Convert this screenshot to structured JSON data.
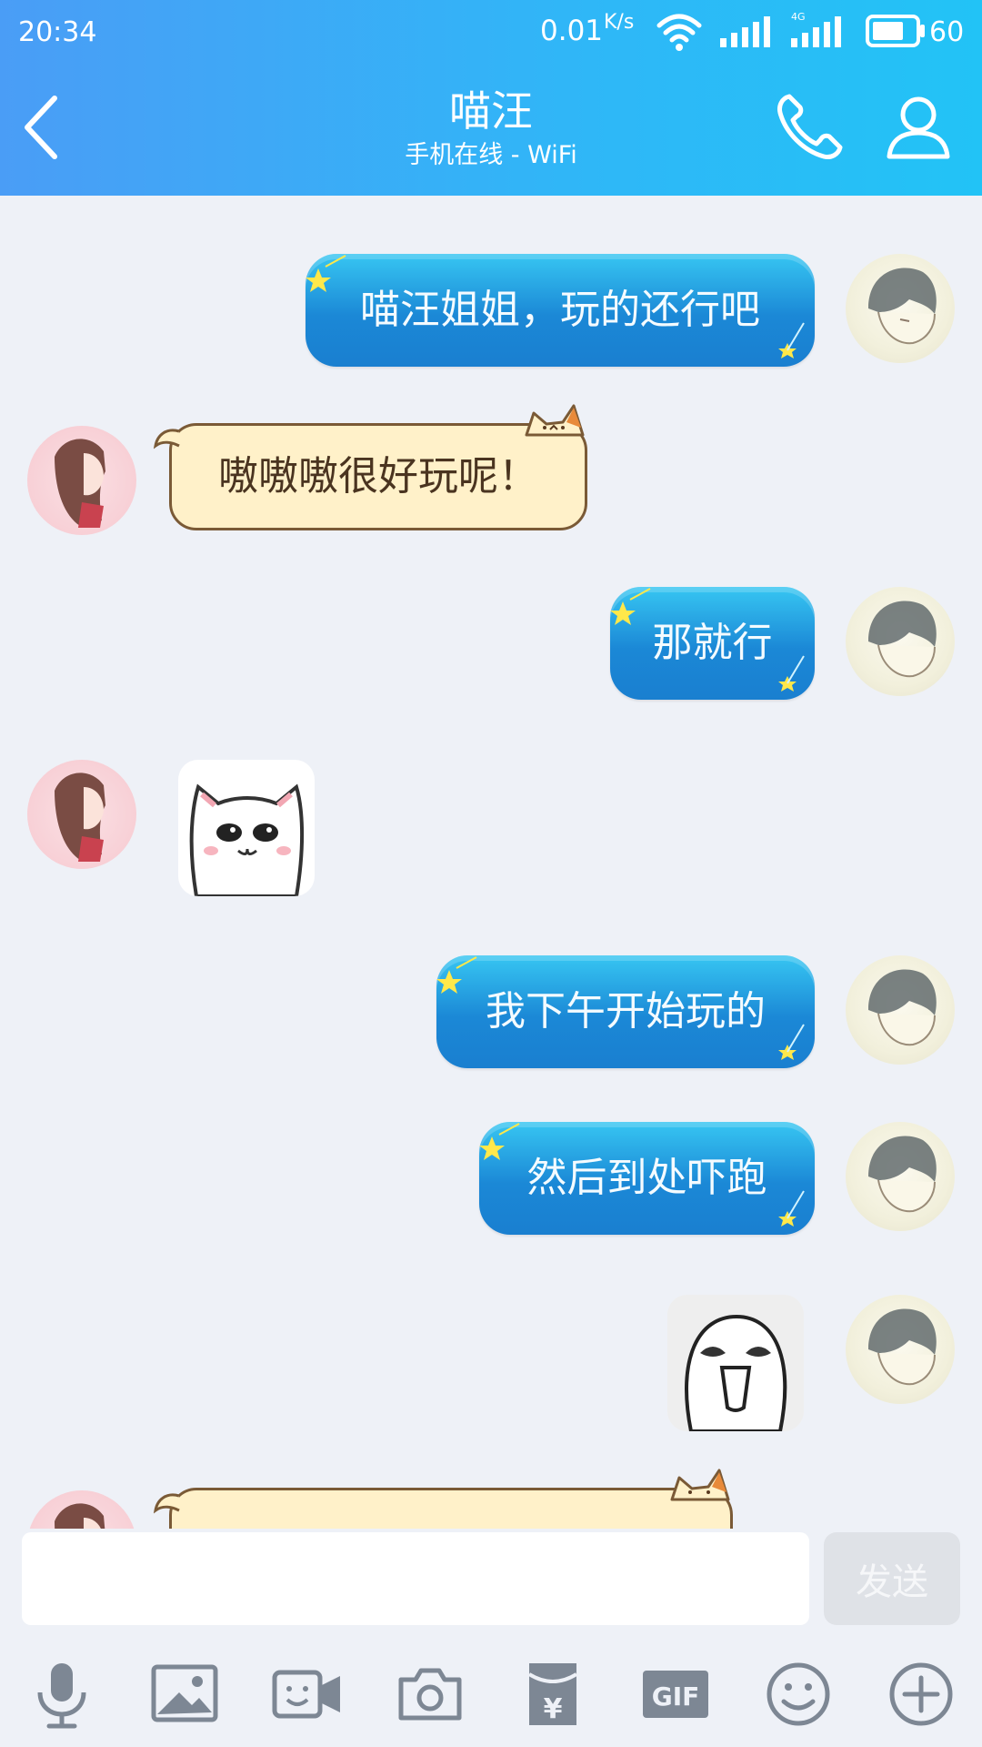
{
  "status_bar": {
    "time": "20:34",
    "net_speed": "0.01",
    "net_unit": "K/s",
    "network_type": "4G",
    "battery": "60"
  },
  "header": {
    "title": "喵汪",
    "subtitle": "手机在线 - WiFi",
    "icons": [
      "back-icon",
      "phone-icon",
      "profile-icon"
    ]
  },
  "messages": [
    {
      "side": "out",
      "type": "text",
      "text": "喵汪姐姐，玩的还行吧"
    },
    {
      "side": "in",
      "type": "text",
      "text": "嗷嗷嗷很好玩呢！"
    },
    {
      "side": "out",
      "type": "text",
      "text": "那就行"
    },
    {
      "side": "in",
      "type": "sticker",
      "sticker": "cat-face-sticker"
    },
    {
      "side": "out",
      "type": "text",
      "text": "我下午开始玩的"
    },
    {
      "side": "out",
      "type": "text",
      "text": "然后到处吓跑"
    },
    {
      "side": "out",
      "type": "sticker",
      "sticker": "laughing-face-sticker"
    },
    {
      "side": "in",
      "type": "text",
      "text": ""
    }
  ],
  "input": {
    "value": "",
    "send_label": "发送"
  },
  "toolbar": [
    "microphone-icon",
    "image-icon",
    "video-call-icon",
    "camera-icon",
    "red-packet-icon",
    "gif-icon",
    "emoji-icon",
    "plus-icon"
  ],
  "colors": {
    "header_start": "#4a9df6",
    "header_end": "#22c3f6",
    "bubble_out": "#1b88d6",
    "bubble_in": "#fff1c9",
    "background": "#eef1f7",
    "icon_gray": "#7d8794"
  }
}
